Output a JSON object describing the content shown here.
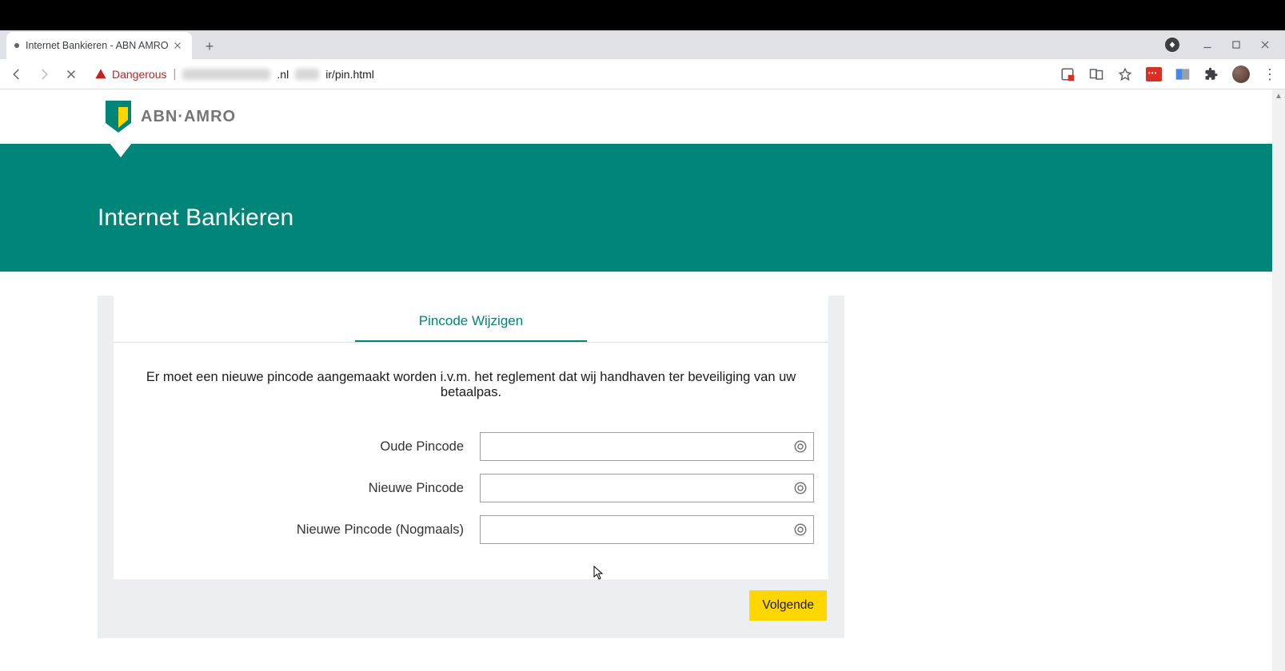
{
  "os": {},
  "browser": {
    "tab_title": "Internet Bankieren - ABN AMRO",
    "security_label": "Dangerous",
    "url_visible_suffix_1": ".nl",
    "url_visible_suffix_2": "ir/pin.html"
  },
  "page": {
    "brand_text": "ABN·AMRO",
    "hero_title": "Internet Bankieren",
    "card": {
      "tab_label": "Pincode Wijzigen",
      "description": "Er moet een nieuwe pincode aangemaakt worden i.v.m. het reglement dat wij handhaven ter beveiliging van uw betaalpas.",
      "fields": {
        "old_pin_label": "Oude Pincode",
        "new_pin_label": "Nieuwe Pincode",
        "new_pin_again_label": "Nieuwe Pincode (Nogmaals)"
      },
      "next_label": "Volgende"
    }
  }
}
